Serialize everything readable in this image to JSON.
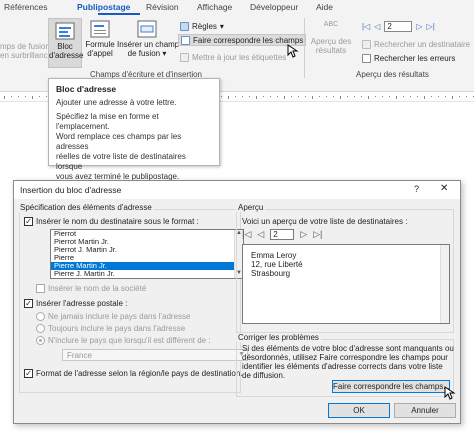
{
  "ribbon": {
    "tabs": [
      {
        "label": "Références"
      },
      {
        "label": "Publipostage"
      },
      {
        "label": "Révision"
      },
      {
        "label": "Affichage"
      },
      {
        "label": "Développeur"
      },
      {
        "label": "Aide"
      }
    ],
    "active_tab": "Publipostage",
    "buttons": {
      "merge_fields_line1": "mps de fusion",
      "merge_fields_line2": "en surbrillance",
      "address_block_line1": "Bloc",
      "address_block_line2": "d'adresse",
      "greeting_line_line1": "Formule",
      "greeting_line_line2": "d'appel",
      "insert_field_line1": "Insérer un champ",
      "insert_field_line2": "de fusion",
      "rules": "Règles",
      "match_fields": "Faire correspondre les champs",
      "update_labels": "Mettre à jour les étiquettes",
      "preview_results_line1": "Aperçu des",
      "preview_results_line2": "résultats",
      "record_number": "2",
      "find_recipient": "Rechercher un destinataire",
      "check_errors": "Rechercher les erreurs",
      "abc": "ABC"
    },
    "group_labels": {
      "write_insert": "Champs d'écriture et d'insertion",
      "preview": "Aperçu des résultats"
    }
  },
  "tooltip": {
    "title": "Bloc d'adresse",
    "lines": [
      "Ajouter une adresse à votre lettre.",
      "",
      "Spécifiez la mise en forme et l'emplacement.",
      "Word remplace ces champs par les adresses",
      "réelles de votre liste de destinataires lorsque",
      "vous avez terminé le publipostage."
    ]
  },
  "dialog": {
    "title": "Insertion du bloc d'adresse",
    "help": "?",
    "close": "✕",
    "spec_legend": "Spécification des éléments d'adresse",
    "insert_name_label": "Insérer le nom du destinataire sous le format :",
    "name_formats": [
      "Pierrot",
      "Pierrot Martin Jr.",
      "Pierrot J. Martin Jr.",
      "Pierre",
      "Pierre Martin Jr.",
      "Pierre J. Martin Jr."
    ],
    "selected_format_index": 4,
    "insert_company_label": "Insérer le nom de la société",
    "insert_postal_label": "Insérer l'adresse postale :",
    "radio_never": "Ne jamais inclure le pays dans l'adresse",
    "radio_always": "Toujours inclure le pays dans l'adresse",
    "radio_only_if": "N'inclure le pays que lorsqu'il est différent de :",
    "country_value": "France",
    "format_by_country_label": "Format de l'adresse selon la région/le pays de destination.",
    "preview_legend": "Aperçu",
    "preview_intro": "Voici un aperçu de votre liste de destinataires :",
    "preview_record": "2",
    "preview_lines": [
      "Emma Leroy",
      "12, rue Liberté",
      "Strasbourg"
    ],
    "fix_legend": "Corriger les problèmes",
    "fix_text": [
      "Si des éléments de votre bloc d'adresse sont manquants ou",
      "désordonnés, utilisez Faire correspondre les champs pour",
      "identifier les éléments d'adresse corrects dans votre liste",
      "de diffusion."
    ],
    "fix_button": "Faire correspondre les champs...",
    "ok": "OK",
    "cancel": "Annuler"
  },
  "colors": {
    "accent": "#185abd",
    "selection": "#0078d7"
  }
}
